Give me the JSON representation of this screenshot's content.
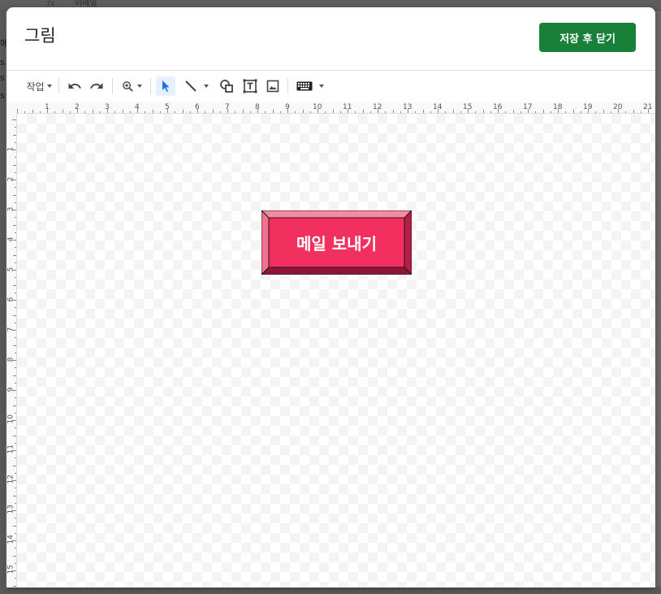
{
  "background": {
    "cells": [
      "fx",
      "이메일"
    ],
    "row_fragments": [
      "메",
      "s",
      "s",
      "s"
    ]
  },
  "dialog": {
    "title": "그림",
    "save_close_label": "저장 후 닫기",
    "accent_color": "#188038"
  },
  "toolbar": {
    "actions_label": "작업",
    "items": [
      {
        "icon": "undo-icon"
      },
      {
        "icon": "redo-icon"
      },
      {
        "icon": "zoom-icon"
      },
      {
        "icon": "select-arrow-icon"
      },
      {
        "icon": "line-icon"
      },
      {
        "icon": "shape-icon"
      },
      {
        "icon": "text-box-icon"
      },
      {
        "icon": "image-icon"
      },
      {
        "icon": "keyboard-icon"
      }
    ]
  },
  "ruler": {
    "horizontal": [
      "1",
      "2",
      "3",
      "4",
      "5",
      "6",
      "7",
      "8",
      "9",
      "10",
      "11",
      "12",
      "13",
      "14",
      "15",
      "16",
      "17",
      "18",
      "19",
      "20",
      "21"
    ],
    "vertical": [
      "1",
      "2",
      "3",
      "4",
      "5",
      "6",
      "7",
      "8",
      "9",
      "10",
      "11",
      "12",
      "13",
      "14",
      "15"
    ]
  },
  "drawing": {
    "button_text": "메일 보내기",
    "fill_color": "#f2305f",
    "outline_color": "#1a1a1a"
  }
}
